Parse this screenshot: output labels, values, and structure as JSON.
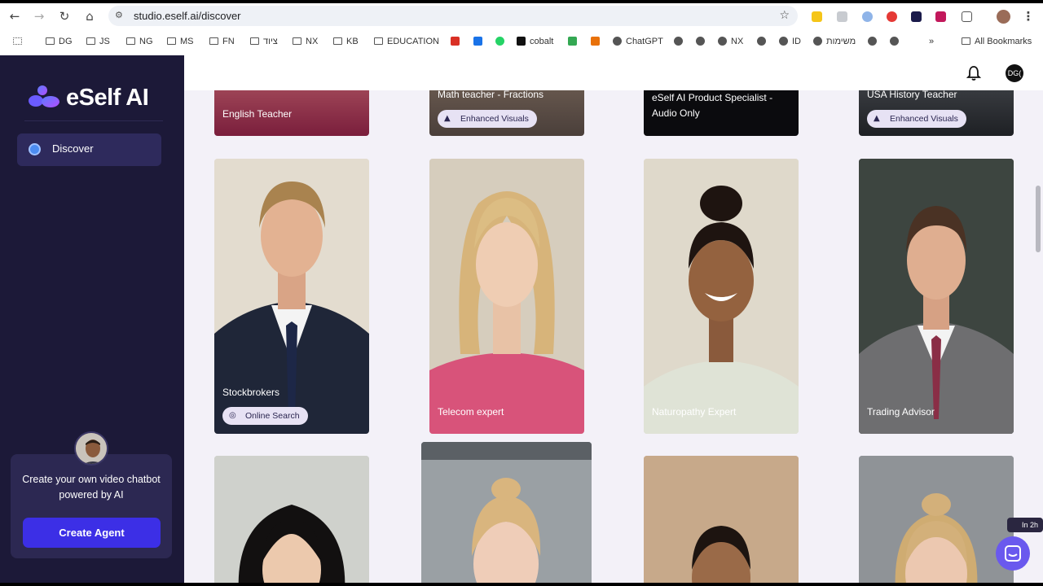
{
  "browser": {
    "url": "studio.eself.ai/discover",
    "bookmarks": [
      {
        "label": "DG",
        "type": "folder"
      },
      {
        "label": "JS",
        "type": "folder"
      },
      {
        "label": "NG",
        "type": "folder"
      },
      {
        "label": "MS",
        "type": "folder"
      },
      {
        "label": "FN",
        "type": "folder"
      },
      {
        "label": "ציוד",
        "type": "folder"
      },
      {
        "label": "NX",
        "type": "folder"
      },
      {
        "label": "KB",
        "type": "folder"
      },
      {
        "label": "EDUCATION",
        "type": "folder"
      },
      {
        "label": "cobalt",
        "type": "link"
      },
      {
        "label": "ChatGPT",
        "type": "link"
      },
      {
        "label": "NX",
        "type": "link"
      },
      {
        "label": "ID",
        "type": "link"
      },
      {
        "label": "משימות",
        "type": "link"
      }
    ],
    "all_bookmarks": "All Bookmarks",
    "more": "»"
  },
  "sidebar": {
    "logo_text": "eSelf AI",
    "nav": [
      {
        "label": "Discover",
        "icon": "globe-icon"
      }
    ],
    "promo_text": "Create your own video chatbot powered by AI",
    "create_button": "Create Agent"
  },
  "topbar": {
    "avatar_initials": "DG("
  },
  "cards_row1": [
    {
      "name": "English Teacher",
      "badge": ""
    },
    {
      "name": "Math teacher - Fractions",
      "badge": "Enhanced Visuals"
    },
    {
      "name": "eSelf AI Product Specialist - Audio Only",
      "badge": ""
    },
    {
      "name": "USA History Teacher",
      "badge": "Enhanced Visuals"
    }
  ],
  "cards_row2": [
    {
      "name": "Stockbrokers",
      "badge": "Online Search"
    },
    {
      "name": "Telecom expert",
      "badge": ""
    },
    {
      "name": "Naturopathy Expert",
      "badge": ""
    },
    {
      "name": "Trading Advisor",
      "badge": ""
    }
  ],
  "in_badge": "In 2h",
  "colors": {
    "sidebar": "#1c1938",
    "accent": "#3c2fe6",
    "badge_bg": "#e7e2f4",
    "video": "#1fbf45"
  }
}
